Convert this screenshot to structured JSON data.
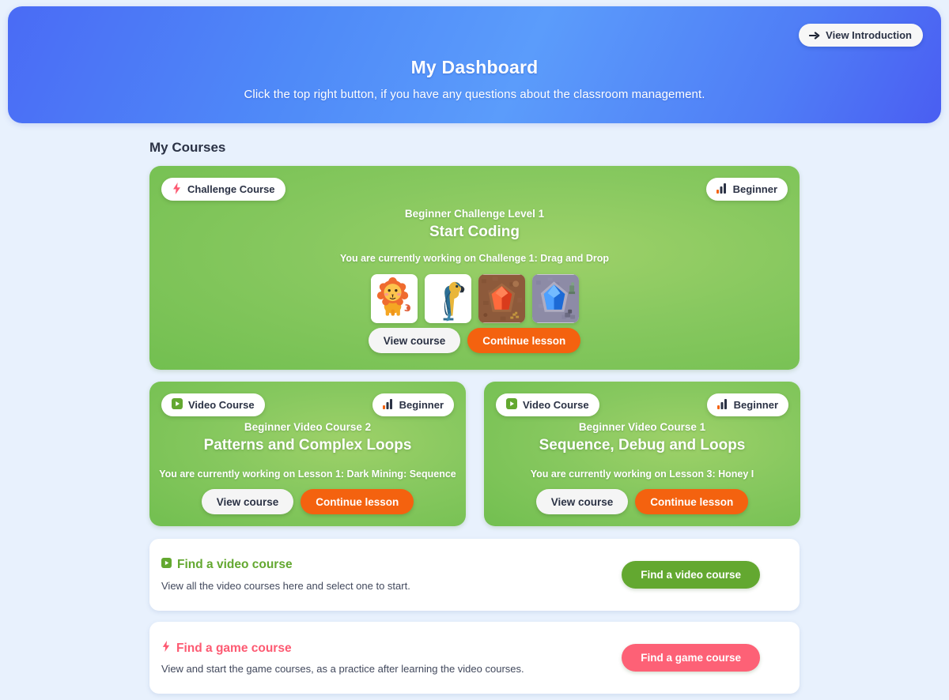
{
  "header": {
    "title": "My Dashboard",
    "subtitle": "Click the top right button, if you have any questions about the classroom management.",
    "intro_button": "View Introduction",
    "intro_icon": "arrow-right-icon",
    "gradient_from": "#4a6bf5",
    "gradient_to": "#4a5ef2"
  },
  "section": {
    "title": "My Courses"
  },
  "courses": [
    {
      "type_badge": "Challenge Course",
      "type_icon": "lightning-bolt-icon",
      "type_icon_color": "#fd5a72",
      "level_badge": "Beginner",
      "level_icon": "signal-bars-icon",
      "eyebrow": "Beginner Challenge Level 1",
      "heading": "Start Coding",
      "progress": "You are currently working on Challenge 1: Drag and Drop",
      "view_label": "View course",
      "continue_label": "Continue lesson",
      "thumbnails": [
        {
          "name": "lion-thumbnail"
        },
        {
          "name": "parrot-thumbnail"
        },
        {
          "name": "red-gem-thumbnail"
        },
        {
          "name": "blue-gem-thumbnail"
        }
      ]
    },
    {
      "type_badge": "Video Course",
      "type_icon": "play-square-icon",
      "type_icon_color": "#63a830",
      "level_badge": "Beginner",
      "level_icon": "signal-bars-icon",
      "eyebrow": "Beginner Video Course 2",
      "heading": "Patterns and Complex Loops",
      "progress": "You are currently working on Lesson 1: Dark Mining: Sequence",
      "view_label": "View course",
      "continue_label": "Continue lesson"
    },
    {
      "type_badge": "Video Course",
      "type_icon": "play-square-icon",
      "type_icon_color": "#63a830",
      "level_badge": "Beginner",
      "level_icon": "signal-bars-icon",
      "eyebrow": "Beginner Video Course 1",
      "heading": "Sequence, Debug and Loops",
      "progress": "You are currently working on Lesson 3: Honey I",
      "view_label": "View course",
      "continue_label": "Continue lesson"
    }
  ],
  "finders": [
    {
      "title": "Find a video course",
      "icon": "play-square-icon",
      "description": "View all the video courses here and select one to start.",
      "button": "Find a video course",
      "color": "#63a830"
    },
    {
      "title": "Find a game course",
      "icon": "lightning-bolt-icon",
      "description": "View and start the game courses, as a practice after learning the video courses.",
      "button": "Find a game course",
      "color": "#fd5a72"
    }
  ]
}
